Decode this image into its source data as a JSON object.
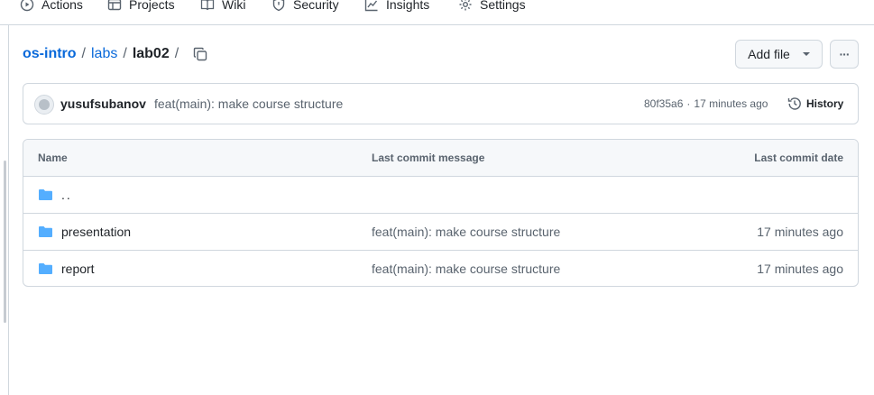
{
  "nav": {
    "tabs": [
      {
        "label": "Actions",
        "icon": "play-circle-icon"
      },
      {
        "label": "Projects",
        "icon": "table-icon"
      },
      {
        "label": "Wiki",
        "icon": "book-icon"
      },
      {
        "label": "Security",
        "icon": "shield-icon"
      },
      {
        "label": "Insights",
        "icon": "graph-icon"
      },
      {
        "label": "Settings",
        "icon": "gear-icon"
      }
    ]
  },
  "breadcrumb": {
    "repo": "os-intro",
    "sep1": "/",
    "folder": "labs",
    "sep2": "/",
    "current": "lab02",
    "sep3": "/"
  },
  "actions": {
    "add_file": "Add file",
    "more": "···"
  },
  "latest_commit": {
    "author": "yusufsubanov",
    "message": "feat(main): make course structure",
    "sha": "80f35a6",
    "dot": "·",
    "time": "17 minutes ago",
    "history_label": "History"
  },
  "files": {
    "headers": {
      "name": "Name",
      "message": "Last commit message",
      "date": "Last commit date"
    },
    "rows": [
      {
        "name": "..",
        "message": "",
        "date": ""
      },
      {
        "name": "presentation",
        "message": "feat(main): make course structure",
        "date": "17 minutes ago"
      },
      {
        "name": "report",
        "message": "feat(main): make course structure",
        "date": "17 minutes ago"
      }
    ]
  },
  "colors": {
    "link": "#0969da",
    "folder": "#54aeff",
    "border": "#d0d7de",
    "muted": "#59636e"
  }
}
